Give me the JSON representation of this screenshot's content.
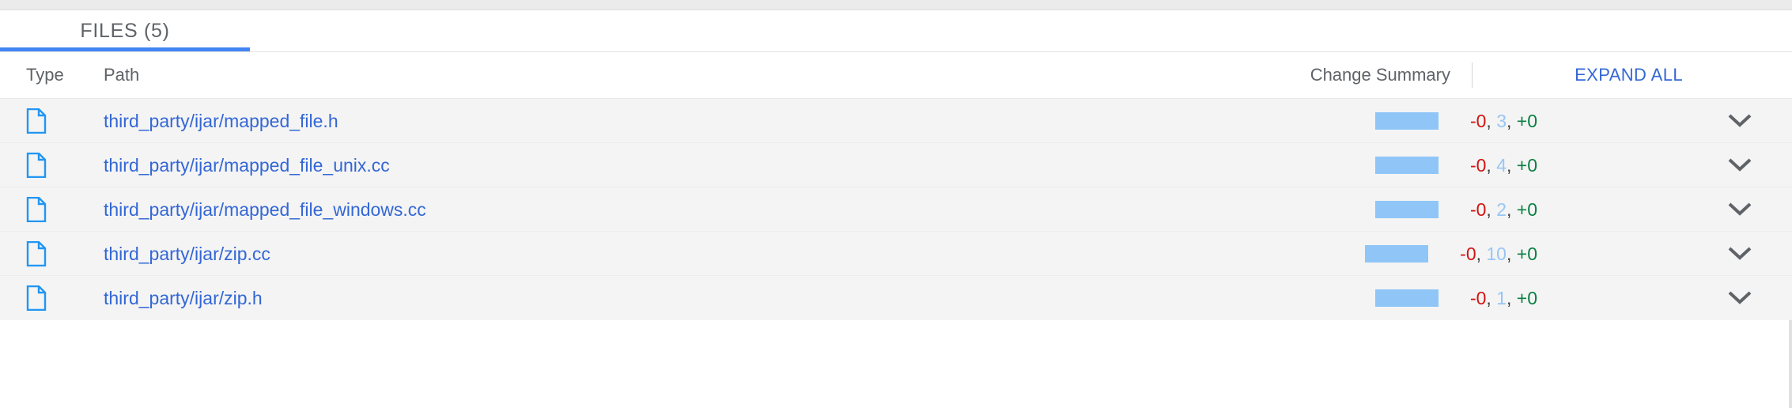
{
  "colors": {
    "accent_blue": "#4285f4",
    "link_blue": "#3367d6",
    "bar_blue": "#8fc6f7",
    "deleted_red": "#d01411",
    "added_green": "#0b8043",
    "modified_blue": "#97c6f5",
    "row_bg": "#f4f4f4",
    "header_text": "#5f6368"
  },
  "tabs": [
    {
      "label": "FILES (5)",
      "selected": true,
      "name": "tab-files"
    }
  ],
  "table": {
    "columns": {
      "type": "Type",
      "path": "Path",
      "change_summary": "Change Summary"
    },
    "expand_all_label": "EXPAND ALL",
    "rows": [
      {
        "type_icon": "file-icon",
        "path": "third_party/ijar/mapped_file.h",
        "deleted": "-0",
        "modified": "3",
        "added": "+0",
        "separator": ", ",
        "bar_width_pct": 100,
        "expand_icon": "chevron-down-icon"
      },
      {
        "type_icon": "file-icon",
        "path": "third_party/ijar/mapped_file_unix.cc",
        "deleted": "-0",
        "modified": "4",
        "added": "+0",
        "separator": ", ",
        "bar_width_pct": 100,
        "expand_icon": "chevron-down-icon"
      },
      {
        "type_icon": "file-icon",
        "path": "third_party/ijar/mapped_file_windows.cc",
        "deleted": "-0",
        "modified": "2",
        "added": "+0",
        "separator": ", ",
        "bar_width_pct": 100,
        "expand_icon": "chevron-down-icon"
      },
      {
        "type_icon": "file-icon",
        "path": "third_party/ijar/zip.cc",
        "deleted": "-0",
        "modified": "10",
        "added": "+0",
        "separator": ", ",
        "bar_width_pct": 100,
        "expand_icon": "chevron-down-icon"
      },
      {
        "type_icon": "file-icon",
        "path": "third_party/ijar/zip.h",
        "deleted": "-0",
        "modified": "1",
        "added": "+0",
        "separator": ", ",
        "bar_width_pct": 100,
        "expand_icon": "chevron-down-icon"
      }
    ]
  }
}
